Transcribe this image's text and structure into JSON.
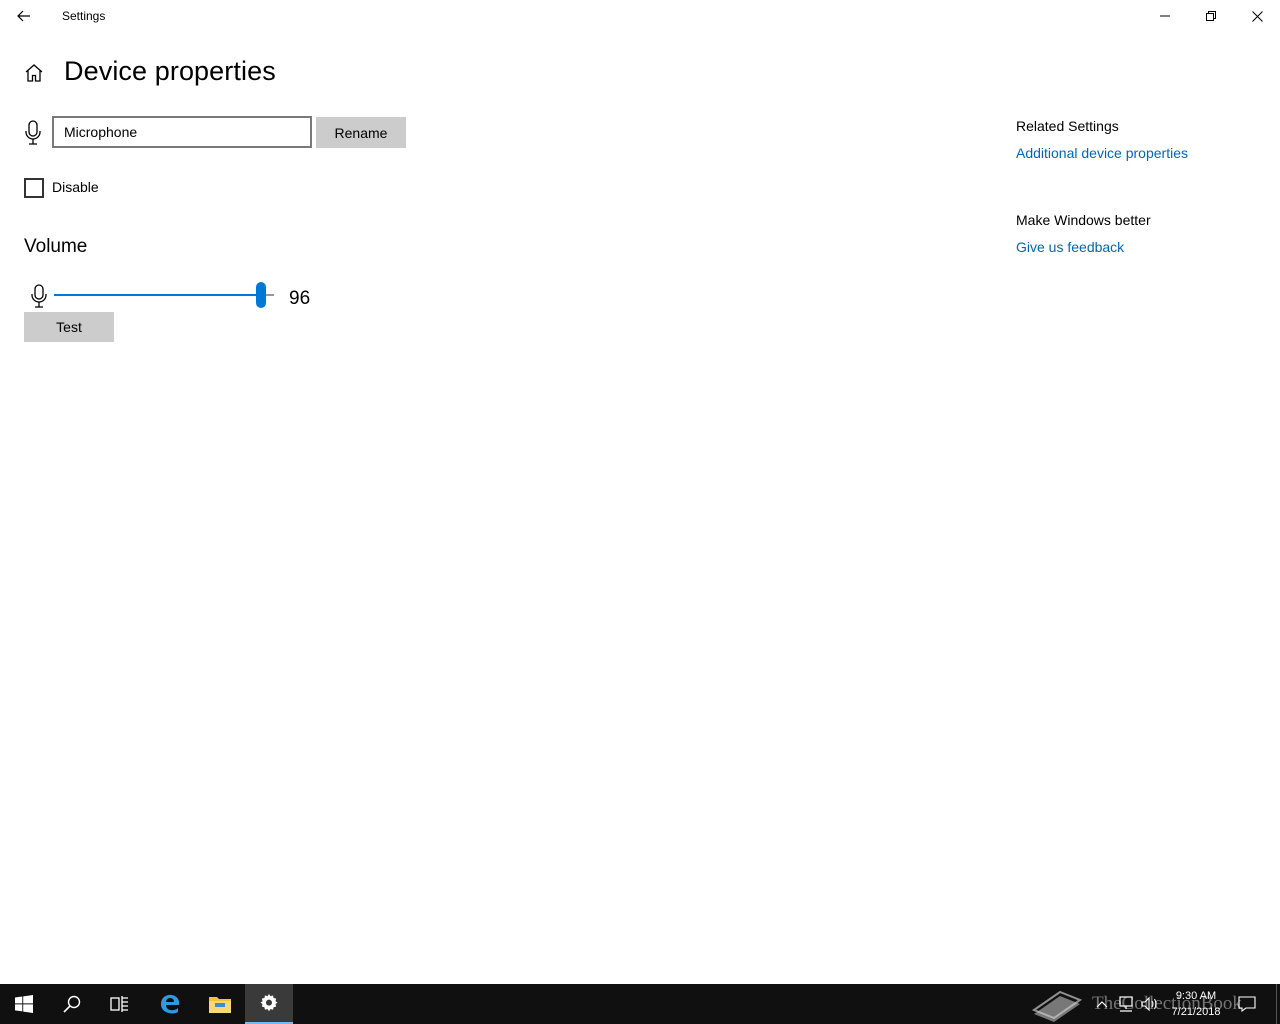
{
  "window": {
    "app_title": "Settings",
    "page_title": "Device properties"
  },
  "device": {
    "name_value": "Microphone",
    "rename_label": "Rename",
    "disable_label": "Disable",
    "disable_checked": false
  },
  "volume": {
    "title": "Volume",
    "level": 96,
    "level_text": "96",
    "test_label": "Test"
  },
  "related": {
    "heading": "Related Settings",
    "link": "Additional device properties"
  },
  "feedback": {
    "heading": "Make Windows better",
    "link": "Give us feedback"
  },
  "taskbar": {
    "time": "9:30 AM",
    "date": "7/21/2018",
    "watermark": "TheCollectionBook",
    "apps": [
      "start-icon",
      "search-icon",
      "task-view-icon",
      "edge-icon",
      "file-explorer-icon",
      "settings-icon"
    ]
  },
  "colors": {
    "accent": "#0078d7",
    "link": "#0067b8",
    "button": "#cccccc",
    "taskbar": "#101010"
  }
}
